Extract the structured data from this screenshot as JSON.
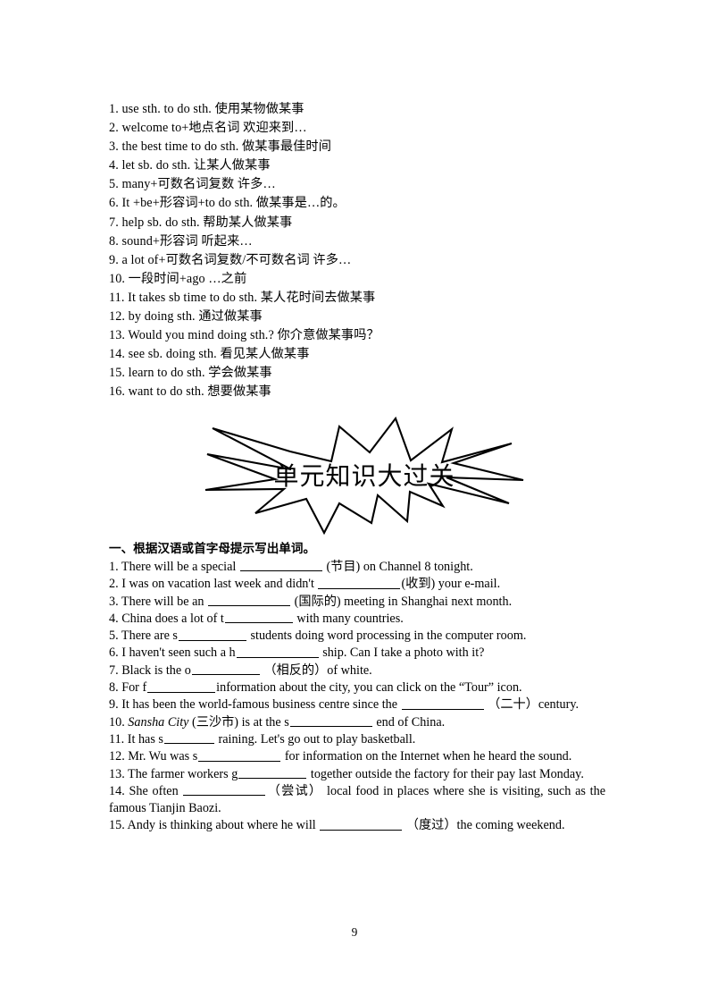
{
  "document": {
    "page_number": "9"
  },
  "phrases": {
    "items": [
      "1. use sth. to do sth. 使用某物做某事",
      "2. welcome to+地点名词 欢迎来到…",
      "3. the best time to do sth. 做某事最佳时间",
      "4. let sb. do sth. 让某人做某事",
      "5. many+可数名词复数 许多…",
      "6. It +be+形容词+to do sth. 做某事是…的。",
      "7. help sb. do sth. 帮助某人做某事",
      "8. sound+形容词 听起来…",
      "9. a lot of+可数名词复数/不可数名词 许多…",
      "10. 一段时间+ago …之前",
      "11. It takes sb time to do sth. 某人花时间去做某事",
      "12. by doing sth. 通过做某事",
      "13. Would you mind doing sth.? 你介意做某事吗？",
      "14. see sb. doing sth. 看见某人做某事",
      "15. learn to do sth. 学会做某事",
      "16. want to do sth. 想要做某事"
    ]
  },
  "banner": {
    "title": "单元知识大过关",
    "shape": "starburst-outline",
    "stroke_color": "#000000",
    "fill_color": "#ffffff"
  },
  "exercise": {
    "heading": "一、根据汉语或首字母提示写出单词。",
    "questions": [
      {
        "number": "1.",
        "parts": [
          {
            "t": "text",
            "v": "1. There will be a special "
          },
          {
            "t": "blank",
            "w": "b-long"
          },
          {
            "t": "text",
            "v": " (节目) on Channel 8 tonight."
          }
        ]
      },
      {
        "number": "2.",
        "parts": [
          {
            "t": "text",
            "v": "2. I was on vacation last week and didn't "
          },
          {
            "t": "blank",
            "w": "b-long"
          },
          {
            "t": "text",
            "v": "(收到) your e-mail."
          }
        ]
      },
      {
        "number": "3.",
        "parts": [
          {
            "t": "text",
            "v": "3. There will be an "
          },
          {
            "t": "blank",
            "w": "b-long"
          },
          {
            "t": "text",
            "v": " (国际的) meeting in Shanghai next month."
          }
        ]
      },
      {
        "number": "4.",
        "parts": [
          {
            "t": "text",
            "v": "4. China does a lot of t"
          },
          {
            "t": "blank",
            "w": "b-med"
          },
          {
            "t": "text",
            "v": " with many countries."
          }
        ]
      },
      {
        "number": "5.",
        "parts": [
          {
            "t": "text",
            "v": "5. There are s"
          },
          {
            "t": "blank",
            "w": "b-med"
          },
          {
            "t": "text",
            "v": "     students doing word processing in the computer room."
          }
        ]
      },
      {
        "number": "6.",
        "parts": [
          {
            "t": "text",
            "v": "6. I haven't seen such a h"
          },
          {
            "t": "blank",
            "w": "b-long"
          },
          {
            "t": "text",
            "v": "    ship. Can I take a photo with it?"
          }
        ]
      },
      {
        "number": "7.",
        "parts": [
          {
            "t": "text",
            "v": "7. Black is the o"
          },
          {
            "t": "blank",
            "w": "b-med"
          },
          {
            "t": "text",
            "v": "  （相反的）of white."
          }
        ]
      },
      {
        "number": "8.",
        "parts": [
          {
            "t": "text",
            "v": "8. For f"
          },
          {
            "t": "blank",
            "w": "b-med"
          },
          {
            "t": "text",
            "v": "information about the city, you can click on the “Tour” icon."
          }
        ]
      },
      {
        "number": "9.",
        "parts": [
          {
            "t": "text",
            "v": "9. It has been the world-famous business centre since the "
          },
          {
            "t": "blank",
            "w": "b-long"
          },
          {
            "t": "text",
            "v": " （二十）century."
          }
        ]
      },
      {
        "number": "10.",
        "parts": [
          {
            "t": "text",
            "v": "10. "
          },
          {
            "t": "italic",
            "v": "Sansha City"
          },
          {
            "t": "text",
            "v": " (三沙市) is at the s"
          },
          {
            "t": "blank",
            "w": "b-long"
          },
          {
            "t": "text",
            "v": " end of China."
          }
        ]
      },
      {
        "number": "11.",
        "parts": [
          {
            "t": "text",
            "v": "11. It has s"
          },
          {
            "t": "blank",
            "w": "b-short"
          },
          {
            "t": "text",
            "v": " raining. Let's go out to play basketball."
          }
        ]
      },
      {
        "number": "12.",
        "parts": [
          {
            "t": "text",
            "v": "12. Mr. Wu was s"
          },
          {
            "t": "blank",
            "w": "b-long"
          },
          {
            "t": "text",
            "v": " for information on the Internet when he heard the sound."
          }
        ]
      },
      {
        "number": "13.",
        "parts": [
          {
            "t": "text",
            "v": "13. The farmer workers g"
          },
          {
            "t": "blank",
            "w": "b-med"
          },
          {
            "t": "text",
            "v": " together outside the factory for their pay last Monday."
          }
        ]
      },
      {
        "number": "14.",
        "parts": [
          {
            "t": "text",
            "v": "14. She often "
          },
          {
            "t": "blank",
            "w": "b-long"
          },
          {
            "t": "text",
            "v": "（尝试） local food in places where she is visiting, such as the famous Tianjin Baozi."
          }
        ]
      },
      {
        "number": "15.",
        "parts": [
          {
            "t": "text",
            "v": "15. Andy is thinking about where he will "
          },
          {
            "t": "blank",
            "w": "b-long"
          },
          {
            "t": "text",
            "v": " （度过）the coming weekend."
          }
        ]
      }
    ]
  }
}
